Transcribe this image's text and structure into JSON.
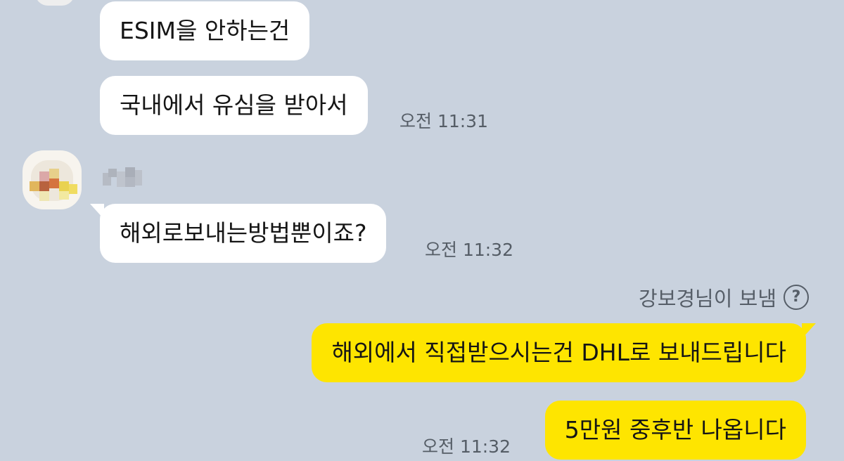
{
  "chat": {
    "messages": [
      {
        "sender": "other",
        "text": "ESIM을 안하는건"
      },
      {
        "sender": "other",
        "text": "국내에서 유심을 받아서",
        "time": "오전 11:31"
      },
      {
        "sender": "other",
        "text": "해외로보내는방법뿐이죠?",
        "time": "오전 11:32"
      },
      {
        "sender": "me",
        "text": "해외에서 직접받으시는건 DHL로 보내드립니다"
      },
      {
        "sender": "me",
        "text": "5만원 중후반 나옵니다",
        "time": "오전 11:32"
      }
    ],
    "sent_by_label": "강보경님이 보냄",
    "help_icon_glyph": "?"
  },
  "colors": {
    "background": "#c9d2de",
    "incoming_bubble": "#ffffff",
    "outgoing_bubble": "#fee500",
    "timestamp_text": "#555d66"
  },
  "icons": {
    "help": "question-circle-icon",
    "avatar": "blurred-profile-avatar"
  }
}
